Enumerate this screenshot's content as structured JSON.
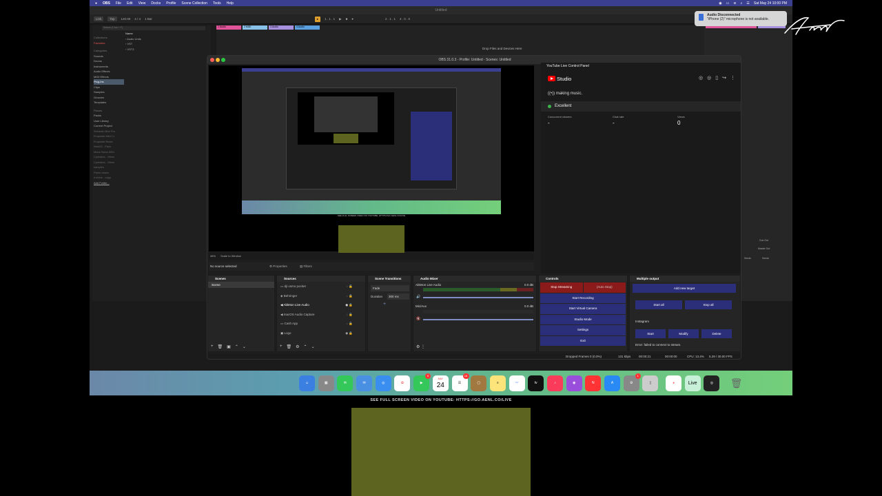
{
  "menubar": {
    "apple": "",
    "items": [
      "OBS",
      "File",
      "Edit",
      "View",
      "Docks",
      "Profile",
      "Scene Collection",
      "Tools",
      "Help"
    ],
    "datetime": "Sat May 24  10:00 PM"
  },
  "ableton": {
    "window_title": "Untitled",
    "link": "Link",
    "tap": "Tap",
    "tempo": "120.00",
    "signature": "4 / 4",
    "quantize": "1 Bar",
    "position": "1 . 1 . 1",
    "position2": "2 . 1 . 1",
    "position3": "4 . 0 . 0",
    "search_placeholder": "Search (Cmd + F)",
    "collections_header": "Collections",
    "favorites": "Favorites",
    "categories_header": "Categories",
    "categories": [
      "Sounds",
      "Drums",
      "Instruments",
      "Audio Effects",
      "MIDI Effects",
      "Plug-Ins",
      "Clips",
      "Samples",
      "Grooves",
      "Templates"
    ],
    "places_header": "Places",
    "places": [
      "Packs",
      "User Library",
      "Current Project",
      "Sebastin Bldr Pro",
      "Exquisite MAX U",
      "Exquisite Beats",
      "Nmk02 - Pack",
      "Mano Nova MIDI",
      "Cymatics - Vibes",
      "Cymatics - Vibes",
      "samples",
      "Piano cases",
      "d.shine - copy",
      "Add Folder..."
    ],
    "name_header": "Name",
    "names": [
      "Audio Units",
      "VST",
      "VST3"
    ],
    "tracks": [
      "1 Audio",
      "2 MIDI",
      "3 Audio",
      "4 Audio"
    ],
    "drop_text": "Drop Files and Devices Here",
    "cue_out": "Cue Out",
    "master_out": "Master Out",
    "sends": "Sends"
  },
  "notification": {
    "title": "Audio Disconnected",
    "body": "\"iPhone (2)\" microphone is not available."
  },
  "obs": {
    "window_title": "OBS 31.0.3 - Profile: Untitled - Scenes: Untitled",
    "zoom": "46%",
    "scale_mode": "Scale to Window",
    "no_source": "No source selected",
    "properties": "Properties",
    "filters": "Filters",
    "preview_caption": "SEE FULL SCREEN VIDEO ON YOUTUBE: HTTPS://GO.AENL.CO/LIVE",
    "youtube": {
      "panel_title": "YouTube Live Control Panel",
      "studio": "Studio",
      "stream_title": "making music.",
      "health": "Excellent",
      "concurrent_label": "Concurrent viewers",
      "concurrent_value": "-",
      "chat_label": "Chat rate",
      "chat_value": "-",
      "views_label": "Views",
      "views_value": "0"
    },
    "scenes": {
      "title": "Scenes",
      "items": [
        "Scene"
      ]
    },
    "sources": {
      "title": "Sources",
      "items": [
        "dji osmo pocket",
        "Behringer",
        "Ableton Live Audio",
        "macOS Audio Capture",
        "Cash App",
        "Logo"
      ]
    },
    "transitions": {
      "title": "Scene Transitions",
      "type": "Fade",
      "duration_label": "Duration",
      "duration_value": "300 ms"
    },
    "mixer": {
      "title": "Audio Mixer",
      "ch1_name": "Ableton Live Audio",
      "ch1_db": "0.0 dB",
      "ch2_name": "Mic/Aux",
      "ch2_db": "0.0 dB"
    },
    "controls": {
      "title": "Controls",
      "stop_streaming": "Stop Streaming",
      "auto_stop": "(Auto Stop)",
      "start_recording": "Start Recording",
      "start_virtual_camera": "Start Virtual Camera",
      "studio_mode": "Studio Mode",
      "settings": "Settings",
      "exit": "Exit"
    },
    "multiple_output": {
      "title": "Multiple output",
      "add_target": "Add new target",
      "start_all": "Start all",
      "stop_all": "Stop all",
      "target_name": "Instagram",
      "start": "Start",
      "modify": "Modify",
      "delete": "Delete",
      "error": "Error: failed to connect to stream."
    },
    "status": {
      "dropped": "Dropped Frames 0 (0.0%)",
      "bitrate": "131 kbps",
      "stream_time": "00:00:21",
      "rec_time": "00:00:00",
      "cpu": "CPU: 13.4%",
      "fps": "5.29 / 30.00 FPS"
    }
  },
  "dock": {
    "calendar_month": "MAY",
    "calendar_day": "24",
    "live_label": "Live",
    "badges": {
      "facetime": "5",
      "reminders": "16",
      "settings": "1"
    }
  },
  "caption": "SEE FULL SCREEN VIDEO ON YOUTUBE: HTTPS://GO.AENL.CO/LIVE"
}
